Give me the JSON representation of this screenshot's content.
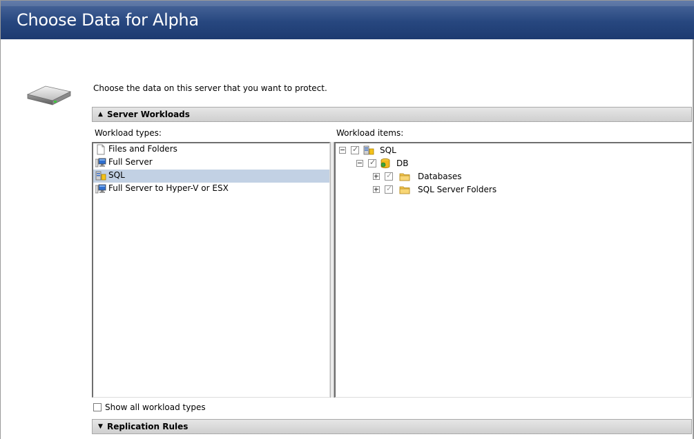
{
  "window": {
    "title": "Choose Data for Alpha"
  },
  "intro": {
    "text": "Choose the data on this server that you want to protect."
  },
  "server_workloads": {
    "label": "Server Workloads",
    "arrow": "▲",
    "workload_types_label": "Workload types:",
    "workload_items_label": "Workload items:",
    "workload_types": [
      {
        "label": "Files and Folders",
        "icon": "file-icon",
        "selected": false
      },
      {
        "label": "Full Server",
        "icon": "server-monitor-icon",
        "selected": false
      },
      {
        "label": "SQL",
        "icon": "sql-server-icon",
        "selected": true
      },
      {
        "label": "Full Server to Hyper-V or ESX",
        "icon": "server-monitor-icon",
        "selected": false
      }
    ],
    "tree": [
      {
        "label": "SQL",
        "icon": "sql-server-icon",
        "expander": "collapse",
        "checked": true
      },
      {
        "label": "DB",
        "icon": "database-icon",
        "expander": "collapse",
        "checked": true
      },
      {
        "label": "Databases",
        "icon": "folder-icon",
        "expander": "expand",
        "checked": true
      },
      {
        "label": "SQL Server Folders",
        "icon": "folder-icon",
        "expander": "expand",
        "checked": true
      }
    ]
  },
  "show_all": {
    "label": "Show all workload types",
    "checked": false
  },
  "replication_rules": {
    "label": "Replication Rules",
    "arrow": "▼"
  },
  "colors": {
    "title_bar": "#27477f",
    "selection": "#c2d1e4",
    "section_header": "#d9d9d9"
  }
}
